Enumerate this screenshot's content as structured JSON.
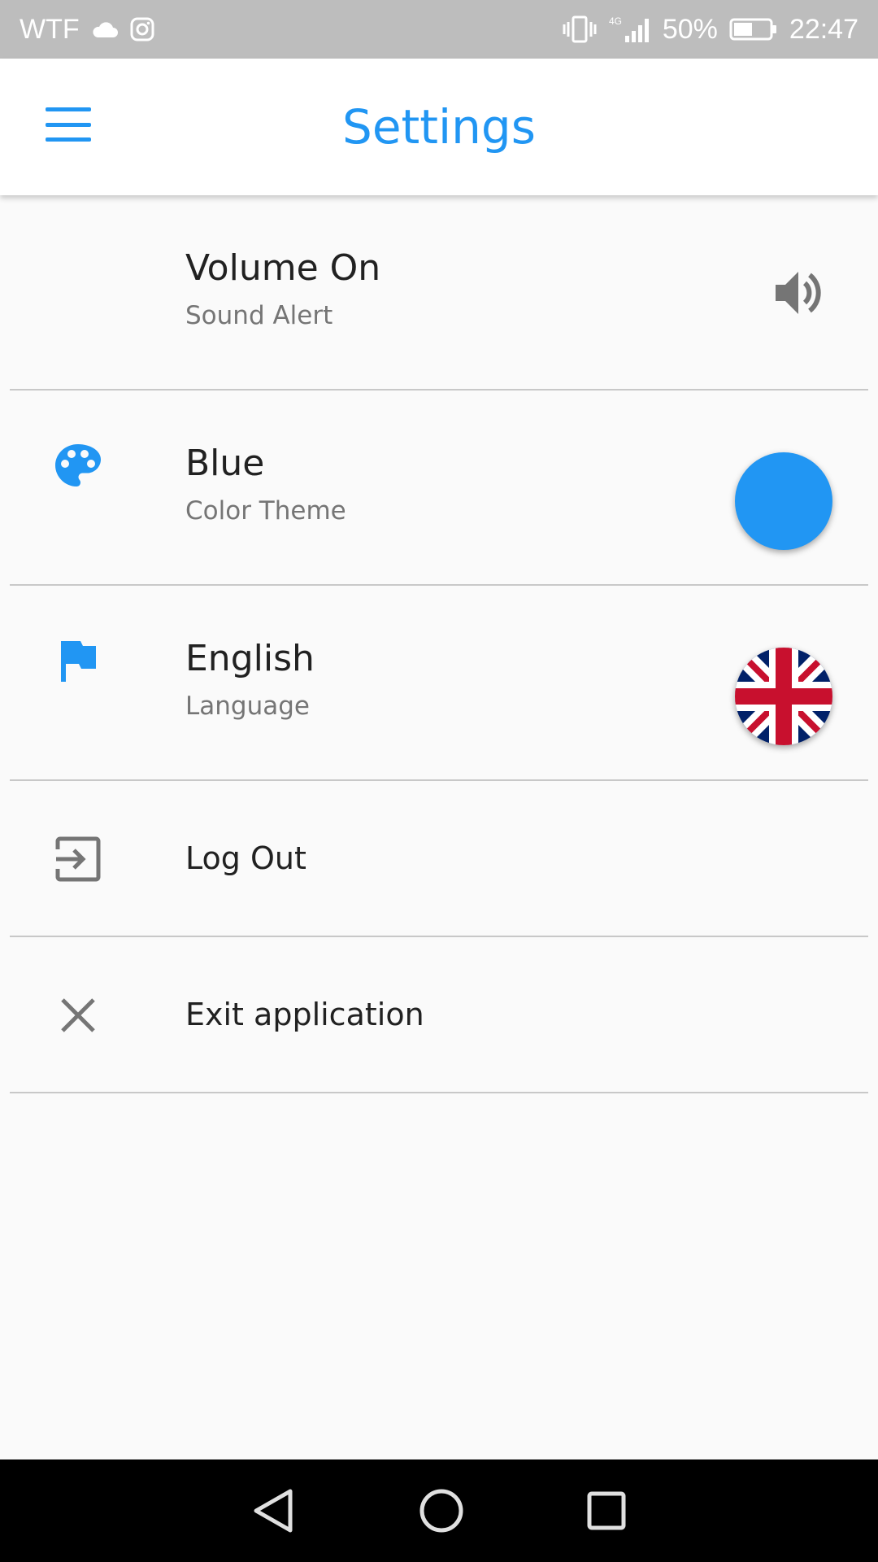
{
  "status_bar": {
    "carrier": "WTF",
    "battery": "50%",
    "time": "22:47"
  },
  "app_bar": {
    "title": "Settings"
  },
  "colors": {
    "accent": "#2196f3",
    "icon_gray": "#757575",
    "divider": "#c8c8c8"
  },
  "settings": [
    {
      "primary": "Volume On",
      "secondary": "Sound Alert",
      "icon": "",
      "trailing": "speaker-icon"
    },
    {
      "primary": "Blue",
      "secondary": "Color Theme",
      "icon": "palette-icon",
      "trailing": "blue-color-circle"
    },
    {
      "primary": "English",
      "secondary": "Language",
      "icon": "flag-icon",
      "trailing": "uk-flag-circle"
    },
    {
      "primary": "Log Out",
      "icon": "exit-to-app-icon"
    },
    {
      "primary": "Exit application",
      "icon": "close-icon"
    }
  ],
  "nav_bar": {
    "back": "back-triangle-icon",
    "home": "home-circle-icon",
    "recents": "recents-square-icon"
  }
}
